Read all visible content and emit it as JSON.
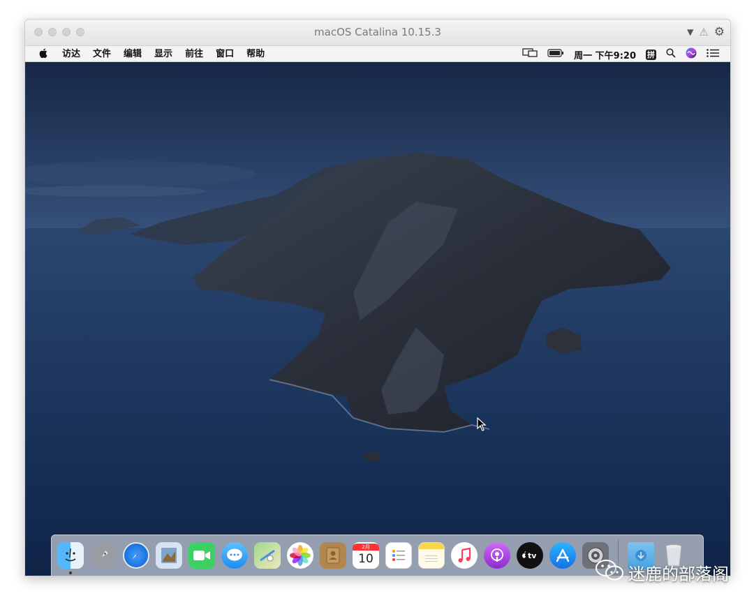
{
  "window": {
    "title": "macOS Catalina 10.15.3"
  },
  "menubar": {
    "apple": "",
    "items": [
      "访达",
      "文件",
      "编辑",
      "显示",
      "前往",
      "窗口",
      "帮助"
    ],
    "clock": "周一 下午9:20",
    "input_method": "拼"
  },
  "dock": {
    "apps": [
      {
        "name": "finder-icon",
        "glyph": "☺",
        "bg": "#3aa4f5"
      },
      {
        "name": "launchpad-icon",
        "glyph": "🚀",
        "bg": "#8c8f96"
      },
      {
        "name": "safari-icon",
        "glyph": "✦",
        "bg": "#1c7cf0"
      },
      {
        "name": "preview-icon",
        "glyph": "✎",
        "bg": "#6b8fb8"
      },
      {
        "name": "facetime-icon",
        "glyph": "☎",
        "bg": "#2ecc55"
      },
      {
        "name": "messages-icon",
        "glyph": "…",
        "bg": "#34aaf7"
      },
      {
        "name": "maps-icon",
        "glyph": "⌖",
        "bg": "#6fc16a"
      },
      {
        "name": "photos-icon",
        "glyph": "✿",
        "bg": "#f2f2f2"
      },
      {
        "name": "contacts-icon",
        "glyph": "☻",
        "bg": "#b68a55"
      },
      {
        "name": "calendar-icon",
        "glyph": "10",
        "bg": "#ffffff"
      },
      {
        "name": "reminders-icon",
        "glyph": "≡",
        "bg": "#ffffff"
      },
      {
        "name": "notes-icon",
        "glyph": "▤",
        "bg": "#f7d64a"
      },
      {
        "name": "music-icon",
        "glyph": "♫",
        "bg": "#fb3c5c"
      },
      {
        "name": "podcasts-icon",
        "glyph": "◉",
        "bg": "#a64ddb"
      },
      {
        "name": "tv-icon",
        "glyph": "tv",
        "bg": "#111111"
      },
      {
        "name": "app-store-icon",
        "glyph": "A",
        "bg": "#1a8cf0"
      },
      {
        "name": "system-preferences-icon",
        "glyph": "⚙",
        "bg": "#7c7c82"
      }
    ],
    "calendar_month": "2月",
    "calendar_day": "10"
  },
  "watermark": {
    "text": "迷鹿的部落阁"
  }
}
